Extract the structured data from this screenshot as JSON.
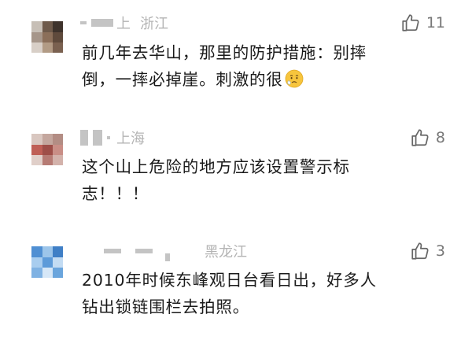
{
  "comments": [
    {
      "location": "浙江",
      "name_visible": "上",
      "likes": "11",
      "lines": [
        "前几年去华山，那里的防护措施：别摔",
        "倒，一摔必掉崖。刺激的很"
      ],
      "emoji": "worried-face-icon"
    },
    {
      "location": "上海",
      "likes": "8",
      "lines": [
        "这个山上危险的地方应该设置警示标",
        "志！！！"
      ]
    },
    {
      "location": "黑龙江",
      "likes": "3",
      "lines": [
        "2010年时候东峰观日台看日出，好多人",
        "钻出锁链围栏去拍照。"
      ]
    }
  ],
  "colors": {
    "text": "#1a1a1a",
    "meta": "#b4b4b4",
    "like": "#777777"
  }
}
